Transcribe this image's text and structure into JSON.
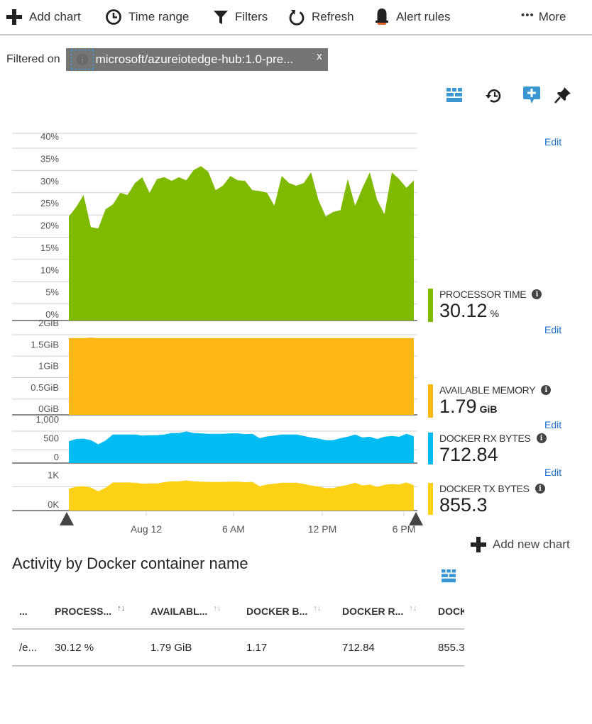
{
  "toolbar": {
    "add_chart": "Add chart",
    "time_range": "Time range",
    "filters": "Filters",
    "refresh": "Refresh",
    "alert_rules": "Alert rules",
    "more": "More"
  },
  "filter": {
    "label": "Filtered on",
    "chip_text": "microsoft/azureiotedge-hub:1.0-pre...",
    "chip_close": "x"
  },
  "chart_actions": {
    "edit": "Edit"
  },
  "legend": [
    {
      "title": "PROCESSOR TIME",
      "value": "30.12",
      "unit": "%",
      "color": "#7fba00",
      "edit": "Edit"
    },
    {
      "title": "AVAILABLE MEMORY",
      "value": "1.79",
      "unit": "GiB",
      "color": "#fcb714",
      "edit": "Edit"
    },
    {
      "title": "DOCKER RX BYTES",
      "value": "712.84",
      "unit": "",
      "color": "#00bcf2",
      "edit": "Edit"
    },
    {
      "title": "DOCKER TX BYTES",
      "value": "855.3",
      "unit": "",
      "color": "#fcd116"
    }
  ],
  "chart_data": [
    {
      "type": "area",
      "title": "Processor Time",
      "ylabel": "",
      "ylim": [
        0,
        40
      ],
      "yticks": [
        "0%",
        "5%",
        "10%",
        "15%",
        "20%",
        "25%",
        "30%",
        "35%",
        "40%"
      ],
      "grid": true,
      "color": "#7fba00",
      "values": [
        23.4,
        25.5,
        28.2,
        21.0,
        20.7,
        25.0,
        26.1,
        28.7,
        28.2,
        30.9,
        32.2,
        28.7,
        31.8,
        32.2,
        31.4,
        32.2,
        31.5,
        33.8,
        34.7,
        33.4,
        29.3,
        30.3,
        32.5,
        31.5,
        31.4,
        29.3,
        29.1,
        28.7,
        25.8,
        32.5,
        30.9,
        30.3,
        30.9,
        33.3,
        27.1,
        23.4,
        24.4,
        24.8,
        31.8,
        25.8,
        29.8,
        33.3,
        27.1,
        23.9,
        33.3,
        31.8,
        29.8,
        31.5
      ]
    },
    {
      "type": "area",
      "title": "Available Memory",
      "ylim": [
        0,
        2
      ],
      "yticks": [
        "0GiB",
        "0.5GiB",
        "1GiB",
        "1.5GiB",
        "2GiB"
      ],
      "grid": true,
      "color": "#fcb714",
      "values": [
        1.79,
        1.79,
        1.79,
        1.8,
        1.79,
        1.79,
        1.79,
        1.79,
        1.79,
        1.79,
        1.79,
        1.79,
        1.79,
        1.79,
        1.79,
        1.79,
        1.79,
        1.79,
        1.79,
        1.79,
        1.79,
        1.79,
        1.79,
        1.79,
        1.79,
        1.79,
        1.79,
        1.79,
        1.79,
        1.79,
        1.79,
        1.79,
        1.79,
        1.79,
        1.79,
        1.79,
        1.79,
        1.79,
        1.79,
        1.79,
        1.79,
        1.79,
        1.79,
        1.79,
        1.79,
        1.79,
        1.79,
        1.79
      ]
    },
    {
      "type": "area",
      "title": "Docker RX Bytes",
      "ylim": [
        0,
        1000
      ],
      "yticks": [
        "0",
        "500",
        "1,000"
      ],
      "grid": true,
      "color": "#00bcf2",
      "values": [
        580,
        640,
        650,
        610,
        500,
        600,
        760,
        760,
        760,
        760,
        730,
        740,
        740,
        760,
        800,
        800,
        840,
        800,
        790,
        780,
        780,
        780,
        790,
        790,
        770,
        780,
        660,
        710,
        730,
        760,
        760,
        760,
        720,
        680,
        650,
        610,
        610,
        660,
        700,
        760,
        680,
        700,
        640,
        700,
        720,
        700,
        780,
        712
      ]
    },
    {
      "type": "area",
      "title": "Docker TX Bytes",
      "ylim": [
        0,
        1200
      ],
      "yticks": [
        "0K",
        "1K"
      ],
      "grid": true,
      "color": "#fcd116",
      "values": [
        740,
        810,
        820,
        780,
        650,
        770,
        950,
        950,
        950,
        940,
        910,
        920,
        920,
        960,
        990,
        990,
        1020,
        990,
        980,
        970,
        970,
        970,
        980,
        980,
        960,
        970,
        820,
        880,
        910,
        940,
        940,
        940,
        900,
        850,
        810,
        760,
        760,
        820,
        870,
        940,
        850,
        880,
        800,
        870,
        900,
        880,
        950,
        855
      ]
    }
  ],
  "x_axis": {
    "ticks": [
      "Aug 12",
      "6 AM",
      "12 PM",
      "6 PM"
    ]
  },
  "add_new_chart": "Add new chart",
  "table": {
    "title": "Activity by Docker container name",
    "columns": [
      "...",
      "PROCESS...",
      "AVAILABL...",
      "DOCKER B...",
      "DOCKER R...",
      "DOCK"
    ],
    "rows": [
      [
        "/e...",
        "30.12 %",
        "1.79 GiB",
        "1.17",
        "712.84",
        "855.3"
      ]
    ]
  }
}
